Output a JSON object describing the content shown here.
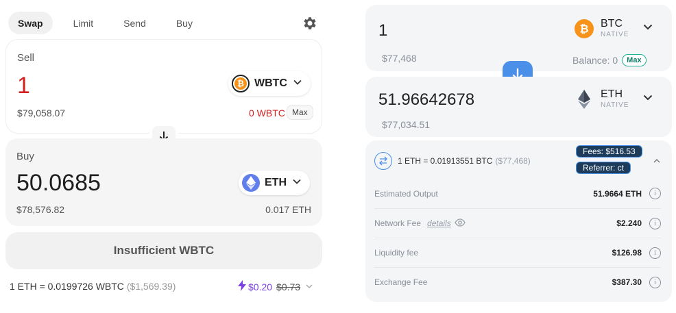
{
  "left": {
    "tabs": [
      {
        "label": "Swap",
        "active": true
      },
      {
        "label": "Limit",
        "active": false
      },
      {
        "label": "Send",
        "active": false
      },
      {
        "label": "Buy",
        "active": false
      }
    ],
    "sell": {
      "label": "Sell",
      "amount": "1",
      "amount_color": "#d32020",
      "fiat": "$79,058.07",
      "token": "WBTC",
      "balance": "0 WBTC",
      "balance_color": "#d32020",
      "max_label": "Max"
    },
    "buy": {
      "label": "Buy",
      "amount": "50.0685",
      "fiat": "$78,576.82",
      "token": "ETH",
      "balance": "0.017 ETH"
    },
    "action_button": "Insufficient WBTC",
    "rate": {
      "text": "1 ETH = 0.0199726 WBTC",
      "fiat": "($1,569.39)"
    },
    "gas": {
      "cost": "$0.20",
      "original": "$0.73"
    }
  },
  "right": {
    "from": {
      "amount": "1",
      "fiat": "$77,468",
      "token": "BTC",
      "chain": "NATIVE",
      "balance_label": "Balance: 0",
      "max_label": "Max"
    },
    "to": {
      "amount": "51.96642678",
      "fiat": "$77,034.51",
      "token": "ETH",
      "chain": "NATIVE"
    },
    "rate": {
      "text": "1 ETH = 0.01913551 BTC",
      "fiat": "($77,468)"
    },
    "badges": {
      "fees": "Fees: $516.53",
      "referrer": "Referrer: ct"
    },
    "details": [
      {
        "label": "Estimated Output",
        "value": "51.9664 ETH"
      },
      {
        "label": "Network Fee",
        "link": "details",
        "value": "$2.240"
      },
      {
        "label": "Liquidity fee",
        "value": "$126.98"
      },
      {
        "label": "Exchange Fee",
        "value": "$387.30"
      }
    ],
    "accent": "#4a90e8"
  },
  "colors": {
    "btc": "#f7931a",
    "eth": "#627eea",
    "purple": "#7b3fe4"
  }
}
